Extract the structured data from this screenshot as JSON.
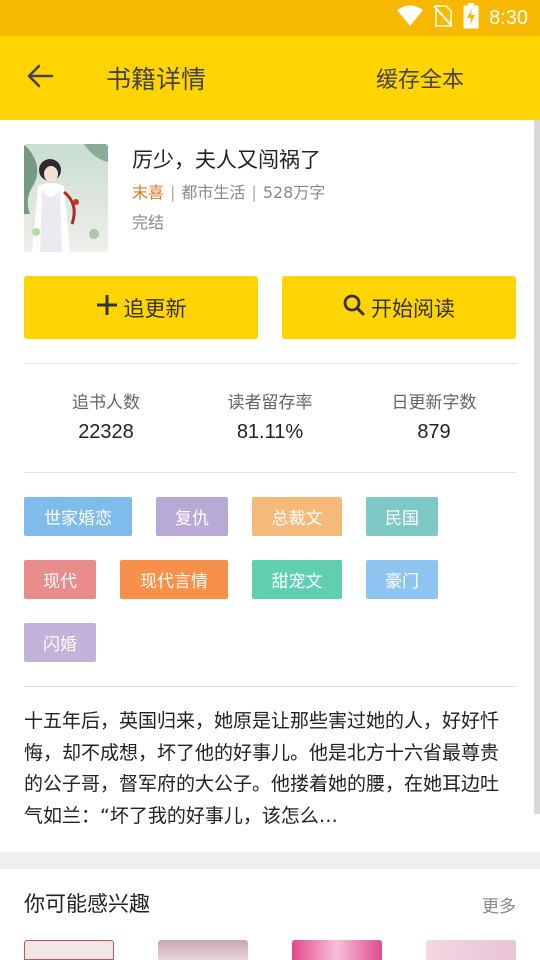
{
  "status_bar": {
    "time": "8:30",
    "icons": [
      "wifi-icon",
      "no-sim-icon",
      "battery-charging-icon"
    ]
  },
  "app_bar": {
    "title": "书籍详情",
    "cache_label": "缓存全本",
    "back_icon": "arrow-left-icon"
  },
  "book": {
    "title": "厉少，夫人又闯祸了",
    "author": "末喜",
    "category": "都市生活",
    "word_count": "528万字",
    "status": "完结"
  },
  "actions": {
    "follow_label": "追更新",
    "read_label": "开始阅读"
  },
  "stats": [
    {
      "label": "追书人数",
      "value": "22328"
    },
    {
      "label": "读者留存率",
      "value": "81.11%"
    },
    {
      "label": "日更新字数",
      "value": "879"
    }
  ],
  "tags": [
    {
      "label": "世家婚恋",
      "color": "#7fbcec"
    },
    {
      "label": "复仇",
      "color": "#b8aad6"
    },
    {
      "label": "总裁文",
      "color": "#f5b97a"
    },
    {
      "label": "民国",
      "color": "#7fc8c8"
    },
    {
      "label": "现代",
      "color": "#e98c8c"
    },
    {
      "label": "现代言情",
      "color": "#f7904a"
    },
    {
      "label": "甜宠文",
      "color": "#5fcfb0"
    },
    {
      "label": "豪门",
      "color": "#8ec5f0"
    },
    {
      "label": "闪婚",
      "color": "#c4b2da"
    }
  ],
  "synopsis": "十五年后，英国归来，她原是让那些害过她的人，好好忏悔，却不成想，坏了他的好事儿。他是北方十六省最尊贵的公子哥，督军府的大公子。他搂着她的腰，在她耳边吐气如兰：“坏了我的好事儿，该怎么…",
  "recommend": {
    "title": "你可能感兴趣",
    "more_label": "更多"
  }
}
